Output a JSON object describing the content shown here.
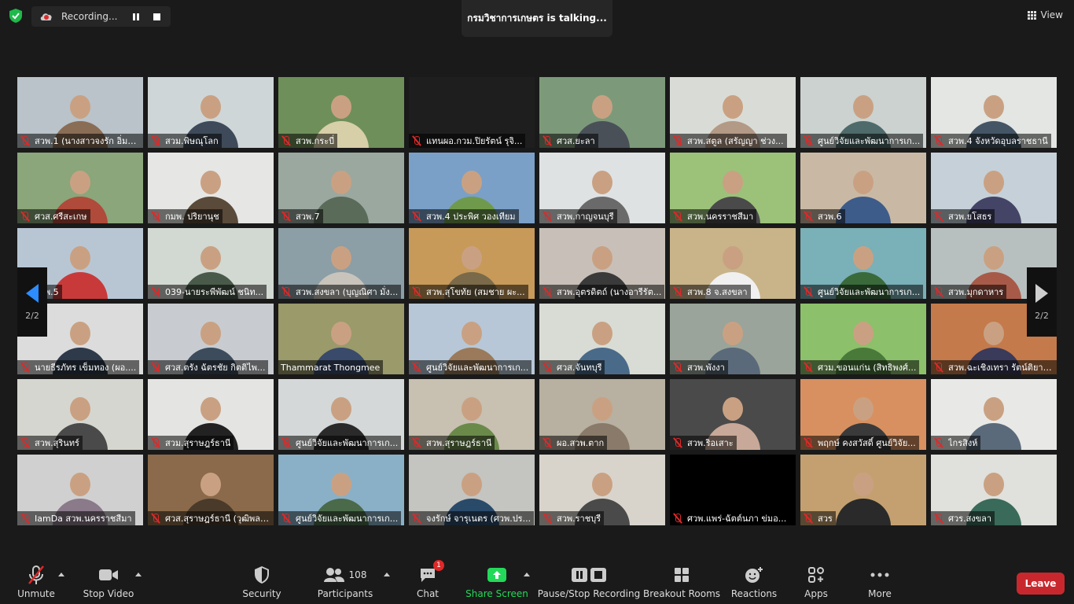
{
  "top": {
    "recording_label": "Recording...",
    "talking_text": "กรมวิชาการเกษตร is talking...",
    "view_label": "View"
  },
  "pager": {
    "page_left": "2/2",
    "page_right": "2/2"
  },
  "tiles": [
    {
      "name": "สวพ.1 (นางสาวจงรัก อิ่มไ...",
      "muted": true
    },
    {
      "name": "สวม.พิษณุโลก",
      "muted": true
    },
    {
      "name": "สวพ.กระบี่",
      "muted": true
    },
    {
      "name": "แทนผอ.กวม.ปิยรัตน์ รุจิ...",
      "muted": true
    },
    {
      "name": "ศวส.ยะลา",
      "muted": true
    },
    {
      "name": "สวพ.สตูล (สรัญญา ช่วง...",
      "muted": true
    },
    {
      "name": "ศูนย์วิจัยและพัฒนาการเก...",
      "muted": true
    },
    {
      "name": "สวพ.4 จังหวัดอุบลราชธานี",
      "muted": true
    },
    {
      "name": "ศวส.ศรีสะเกษ",
      "muted": true
    },
    {
      "name": "กมพ. ปริยานุช",
      "muted": true
    },
    {
      "name": "สวพ.7",
      "muted": true
    },
    {
      "name": "สวพ.4 ประพิศ วองเทียม",
      "muted": true
    },
    {
      "name": "สวพ.กาญจนบุรี",
      "muted": true
    },
    {
      "name": "สวพ.นครราชสีมา",
      "muted": true
    },
    {
      "name": "สวพ.6",
      "muted": true
    },
    {
      "name": "สวพ.ยโสธร",
      "muted": true
    },
    {
      "name": "สวพ.5",
      "muted": true
    },
    {
      "name": "039-นายระพีพัฒน์ ชนิท...",
      "muted": true
    },
    {
      "name": "สวพ.สงขลา (บุญณิศา มั่ง...",
      "muted": true
    },
    {
      "name": "สวพ.สุโขทัย (สมชาย ผะ...",
      "muted": true
    },
    {
      "name": "สวพ.อุตรดิตถ์ (นางอารีรัต...",
      "muted": true
    },
    {
      "name": "สวพ.8 จ.สงขลา",
      "muted": true
    },
    {
      "name": "ศูนย์วิจัยและพัฒนาการเก...",
      "muted": true
    },
    {
      "name": "สวพ.มุกดาหาร",
      "muted": true
    },
    {
      "name": "นายธีรภัทร เข็มทอง (ผอ....",
      "muted": true
    },
    {
      "name": "ศวส.ตรัง ฉัตรชัย กิตติไพ...",
      "muted": true
    },
    {
      "name": "Thammarat Thongmee",
      "muted": false
    },
    {
      "name": "ศูนย์วิจัยและพัฒนาการเก...",
      "muted": true
    },
    {
      "name": "ศวส.จันทบุรี",
      "muted": true
    },
    {
      "name": "สวพ.พังงา",
      "muted": true
    },
    {
      "name": "ศวม.ขอนแก่น (สิทธิพงศ์...",
      "muted": true
    },
    {
      "name": "สวพ.ฉะเชิงเทรา รัตน์ติยา ...",
      "muted": true
    },
    {
      "name": "สวพ.สุรินทร์",
      "muted": true
    },
    {
      "name": "สวม.สุราษฎร์ธานี",
      "muted": true
    },
    {
      "name": "ศูนย์วิจัยและพัฒนาการเก...",
      "muted": true
    },
    {
      "name": "สวพ.สุราษฎร์ธานี",
      "muted": true
    },
    {
      "name": "ผอ.สวพ.ตาก",
      "muted": true
    },
    {
      "name": "สวพ.ริอเสาะ",
      "muted": true
    },
    {
      "name": "พฤกษ์ คงสวัสดิ์ ศูนย์วิจัย...",
      "muted": true
    },
    {
      "name": "ไกรสิงห์",
      "muted": true
    },
    {
      "name": "IamDa สวพ.นครราชสีมา",
      "muted": true
    },
    {
      "name": "ศวส.สุราษฎร์ธานี (วุฒิพล ...",
      "muted": true
    },
    {
      "name": "ศูนย์วิจัยและพัฒนาการเก...",
      "muted": true
    },
    {
      "name": "จงรักษ์ จารุเนตร (ศวพ.ปร...",
      "muted": true
    },
    {
      "name": "สวพ.ราชบุรี",
      "muted": true
    },
    {
      "name": "ศวพ.แพร่-ฉัตต์นภา ข่มอ...",
      "muted": true
    },
    {
      "name": "สวร",
      "muted": true
    },
    {
      "name": "ศวร.สงขลา",
      "muted": true
    }
  ],
  "toolbar": {
    "unmute": "Unmute",
    "stop_video": "Stop Video",
    "security": "Security",
    "participants": "Participants",
    "participants_count": "108",
    "chat": "Chat",
    "chat_badge": "1",
    "share_screen": "Share Screen",
    "pause_stop_recording": "Pause/Stop Recording",
    "breakout_rooms": "Breakout Rooms",
    "reactions": "Reactions",
    "apps": "Apps",
    "more": "More",
    "leave": "Leave"
  },
  "colors": {
    "background": "#1a1a1a",
    "accent_blue": "#2d8cff",
    "share_green": "#23d959",
    "leave_red": "#c8282d",
    "muted_red": "#e02828"
  }
}
